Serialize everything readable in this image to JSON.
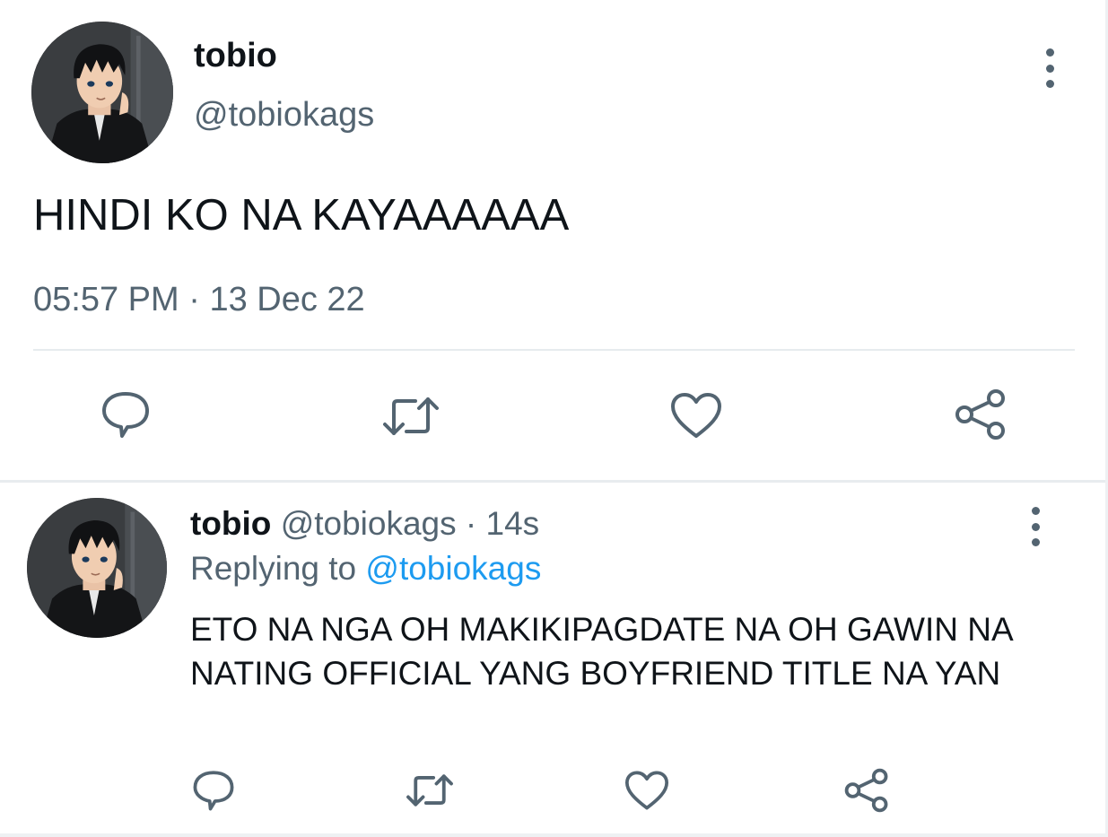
{
  "main_tweet": {
    "display_name": "tobio",
    "handle": "@tobiokags",
    "text": "HINDI KO NA KAYAAAAAA",
    "time": "05:57 PM",
    "separator": "·",
    "date": "13 Dec 22",
    "avatar_icon": "anime-profile-avatar",
    "more_icon": "more-vertical-icon"
  },
  "reply_tweet": {
    "display_name": "tobio",
    "handle": "@tobiokags",
    "separator": "·",
    "age": "14s",
    "replying_prefix": "Replying to",
    "replying_handle": "@tobiokags",
    "text": "ETO NA NGA OH MAKIKIPAGDATE NA OH GAWIN NA NATING OFFICIAL YANG BOYFRIEND TITLE NA YAN",
    "avatar_icon": "anime-profile-avatar",
    "more_icon": "more-vertical-icon"
  },
  "actions": [
    "reply-icon",
    "retweet-icon",
    "like-icon",
    "share-icon"
  ],
  "colors": {
    "text_primary": "#0f1419",
    "text_secondary": "#536471",
    "link": "#1d9bf0",
    "icon": "#536471",
    "divider": "#e6ebee"
  }
}
